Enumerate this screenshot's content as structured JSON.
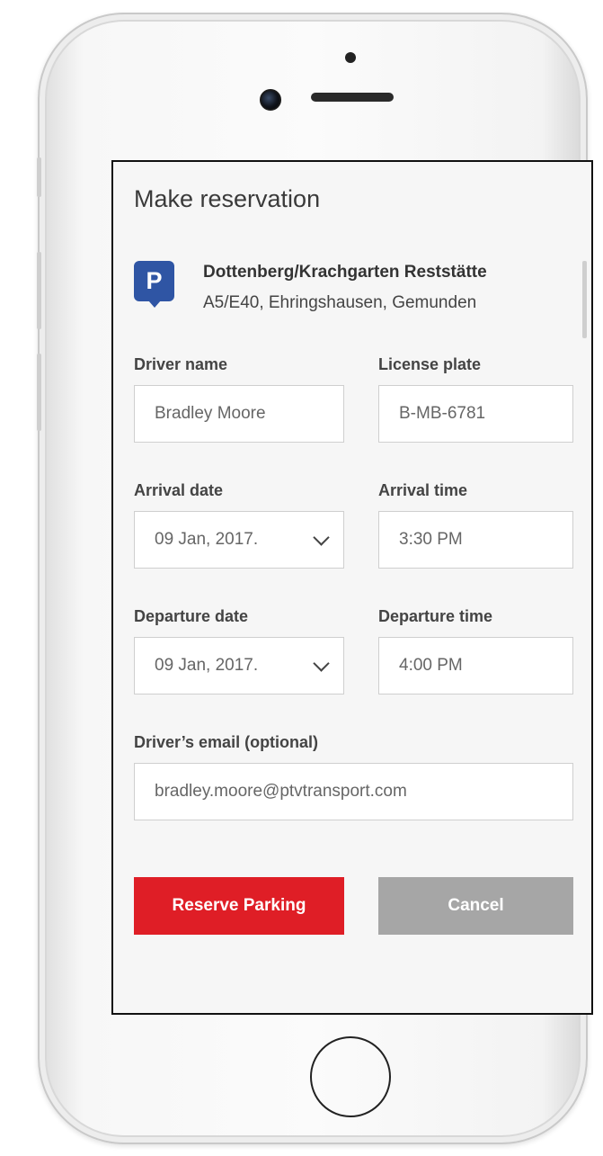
{
  "screen": {
    "title": "Make reservation",
    "location": {
      "icon": "parking-icon",
      "icon_letter": "P",
      "name": "Dottenberg/Krachgarten Reststätte",
      "address": "A5/E40, Ehringshausen, Gemunden"
    },
    "fields": {
      "driver_name": {
        "label": "Driver name",
        "value": "Bradley Moore"
      },
      "license_plate": {
        "label": "License plate",
        "value": "B-MB-6781"
      },
      "arrival_date": {
        "label": "Arrival date",
        "value": "09 Jan, 2017."
      },
      "arrival_time": {
        "label": "Arrival time",
        "value": "3:30 PM"
      },
      "departure_date": {
        "label": "Departure date",
        "value": "09 Jan, 2017."
      },
      "departure_time": {
        "label": "Departure time",
        "value": "4:00 PM"
      },
      "email": {
        "label": "Driver’s email (optional)",
        "value": "bradley.moore@ptvtransport.com"
      }
    },
    "buttons": {
      "reserve": "Reserve Parking",
      "cancel": "Cancel"
    }
  },
  "colors": {
    "primary": "#df1e26",
    "secondary": "#a6a6a6",
    "parking_icon": "#2f55a4"
  }
}
